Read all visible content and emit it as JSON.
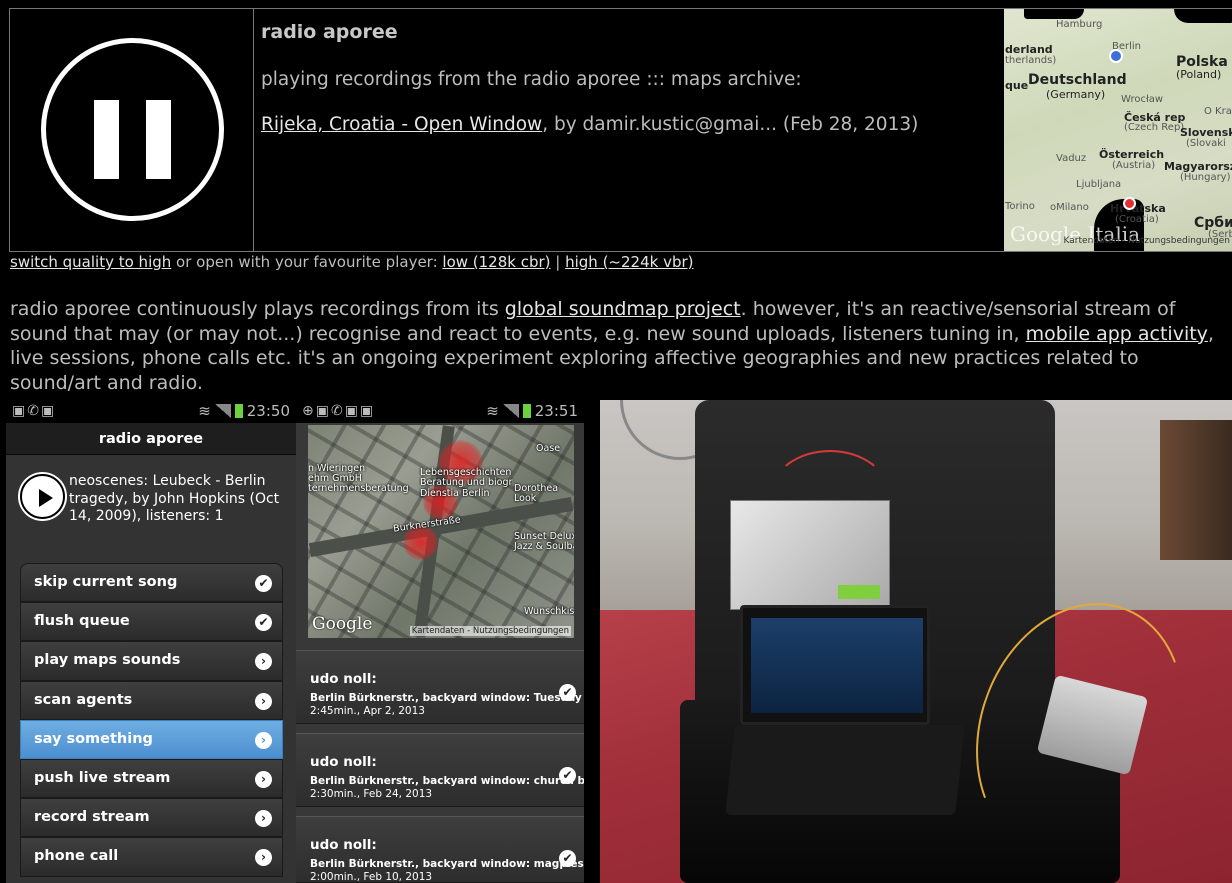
{
  "player": {
    "station_title": "radio aporee",
    "playing_label": "playing recordings from the radio aporee ::: maps archive:",
    "track_link": "Rijeka, Croatia - Open Window",
    "track_rest": ", by damir.kustic@gmai... (Feb 28, 2013)",
    "map": {
      "labels": {
        "hamburg": "Hamburg",
        "nederland": "derland",
        "netherlands": "therlands)",
        "berlin": "Berlin",
        "polska": "Polska",
        "poland": "(Poland)",
        "que": "que",
        "deutschland": "Deutschland",
        "germany": "(Germany)",
        "wroclaw": "Wrocław",
        "okra": "O Kra",
        "ceska": "Česká rep",
        "czech": "(Czech Rep)",
        "slovensk": "Slovensk",
        "slovakia": "(Slovaki",
        "vaduz": "Vaduz",
        "osterreich": "Österreich",
        "austria": "(Austria)",
        "magyar": "Magyarorsz",
        "hungary": "(Hungary)",
        "ljubljana": "Ljubljana",
        "torino": "Torino",
        "milano": "oMilano",
        "hrvatska": "Hrvatska",
        "croatia": "(Croatia)",
        "srbija": "Србиј",
        "serbia": "(Serbia"
      },
      "watermark": "Google Italia",
      "terms": "Kartendaten - Nutzungsbedingungen"
    }
  },
  "quality": {
    "switch_link": "switch quality to high",
    "middle_text": " or open with your favourite player: ",
    "low_link": "low (128k cbr)",
    "separator": " | ",
    "high_link": "high (~224k vbr)"
  },
  "description": {
    "part1": "radio aporee continuously plays recordings from its ",
    "link1": "global soundmap project",
    "part2": ". however, it's an reactive/sensorial stream of sound that may (or may not...) recognise and react to events, e.g. new sound uploads, listeners tuning in, ",
    "link2": "mobile app activity",
    "part3": ", live sessions, phone calls etc. it's an ongoing experiment exploring affective geographies and new practices related to sound/art and radio."
  },
  "phone_left": {
    "time": "23:50",
    "header": "radio aporee",
    "now_playing": "neoscenes: Leubeck - Berlin tragedy, by John Hopkins (Oct 14, 2009), listeners: 1",
    "menu": [
      {
        "label": "skip current song",
        "icon": "check-icon"
      },
      {
        "label": "flush queue",
        "icon": "check-icon"
      },
      {
        "label": "play maps sounds",
        "icon": "chevron-right-icon"
      },
      {
        "label": "scan agents",
        "icon": "chevron-right-icon"
      },
      {
        "label": "say something",
        "icon": "chevron-right-icon",
        "active": true
      },
      {
        "label": "push live stream",
        "icon": "chevron-right-icon"
      },
      {
        "label": "record stream",
        "icon": "chevron-right-icon"
      },
      {
        "label": "phone call",
        "icon": "chevron-right-icon"
      }
    ]
  },
  "phone_mid": {
    "time": "23:51",
    "map_labels": {
      "wieringen": "n Wieringen",
      "gmbh": "ehm GmbH",
      "beratung": "ternehmensberatung",
      "lebens": "Lebensgeschichten",
      "biogr": "Beratung und biogr",
      "dienstia": "Dienstia Berlin",
      "oase": "Oase",
      "dorothea": "Dorothea",
      "look": "Look",
      "burkner": "Burknerstraße",
      "sunset": "Sunset Deluxe",
      "jazz": "Jazz & Soulband",
      "wunsch": "Wunschkist"
    },
    "map_watermark": "Google",
    "map_terms": "Kartendaten - Nutzungsbedingungen",
    "recordings": [
      {
        "author": "udo noll:",
        "desc": "Berlin Bürknerstr., backyard window: Tuesday l...",
        "meta": "2:45min., Apr 2, 2013"
      },
      {
        "author": "udo noll:",
        "desc": "Berlin Bürknerstr., backyard window: church be...",
        "meta": "2:30min., Feb 24, 2013"
      },
      {
        "author": "udo noll:",
        "desc": "Berlin Bürknerstr., backyard window: magpies a...",
        "meta": "2:00min., Feb 10, 2013"
      }
    ]
  },
  "glyphs": {
    "check": "✔",
    "chevron": "›",
    "status_left_icons": "▣✆▣",
    "status_mid_icons": "⊕▣✆▣▣",
    "wifi": "≋"
  },
  "colors": {
    "active_item": "#5a9ddb",
    "signal_green": "#6bd23c",
    "pin_red": "#e23030",
    "pin_blue": "#3d6fd8"
  }
}
